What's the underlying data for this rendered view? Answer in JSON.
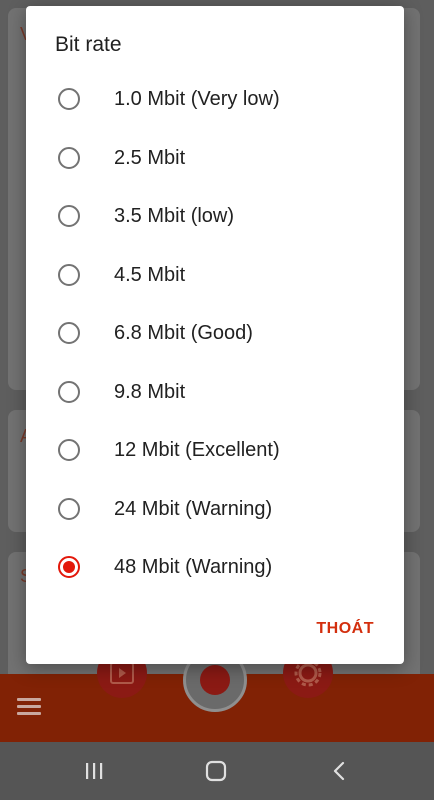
{
  "dialog": {
    "title": "Bit rate",
    "options": [
      {
        "label": "1.0 Mbit (Very low)",
        "selected": false
      },
      {
        "label": "2.5 Mbit",
        "selected": false
      },
      {
        "label": "3.5 Mbit (low)",
        "selected": false
      },
      {
        "label": "4.5 Mbit",
        "selected": false
      },
      {
        "label": "6.8 Mbit (Good)",
        "selected": false
      },
      {
        "label": "9.8 Mbit",
        "selected": false
      },
      {
        "label": "12 Mbit (Excellent)",
        "selected": false
      },
      {
        "label": "24 Mbit (Warning)",
        "selected": false
      },
      {
        "label": "48 Mbit (Warning)",
        "selected": true
      }
    ],
    "action_label": "THOÁT"
  },
  "background": {
    "card_letters": [
      "V",
      "A",
      "S"
    ]
  },
  "icons": {
    "menu": "hamburger-menu-icon",
    "video_library": "video-library-icon",
    "record": "record-icon",
    "settings": "gear-icon",
    "nav_recents": "recents-icon",
    "nav_home": "home-icon",
    "nav_back": "back-icon"
  },
  "colors": {
    "accent": "#e3180b",
    "action_text": "#d32f0e",
    "bottom_bar": "#812205",
    "scrim": "#5e5e5e"
  }
}
